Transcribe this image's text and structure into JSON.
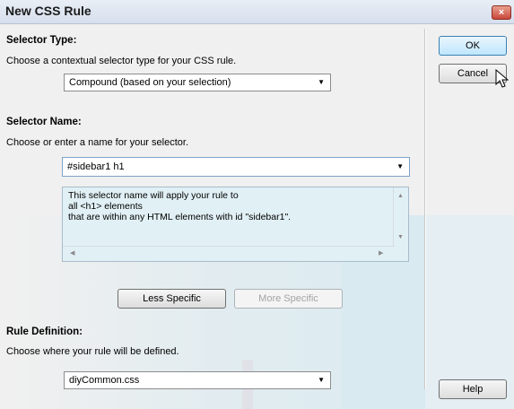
{
  "dialog": {
    "title": "New CSS Rule",
    "close_label": "×"
  },
  "selector_type": {
    "heading": "Selector Type:",
    "instruction": "Choose a contextual selector type for your CSS rule.",
    "selected": "Compound (based on your selection)"
  },
  "selector_name": {
    "heading": "Selector Name:",
    "instruction": "Choose or enter a name for your selector.",
    "value": "#sidebar1 h1",
    "description": "This selector name will apply your rule to\nall <h1> elements\nthat are within any HTML elements with id \"sidebar1\"."
  },
  "specificity": {
    "less_label": "Less Specific",
    "more_label": "More Specific"
  },
  "rule_definition": {
    "heading": "Rule Definition:",
    "instruction": "Choose where your rule will be defined.",
    "selected": "diyCommon.css"
  },
  "buttons": {
    "ok": "OK",
    "cancel": "Cancel",
    "help": "Help"
  }
}
